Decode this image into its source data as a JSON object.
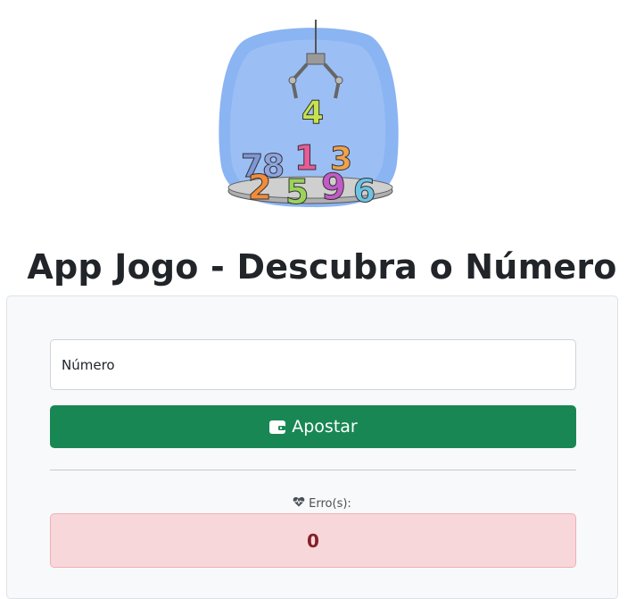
{
  "page": {
    "title": "App Jogo - Descubra o Número"
  },
  "hero": {
    "image_icon": "claw-machine-numbers-illustration",
    "numbers": [
      "4",
      "7",
      "8",
      "1",
      "3",
      "2",
      "5",
      "9",
      "6"
    ]
  },
  "form": {
    "placeholder": "Número"
  },
  "bet_button": {
    "label": "Apostar",
    "icon": "wallet-icon",
    "color": "#198754"
  },
  "errors": {
    "label": "Erro(s):",
    "icon": "heart-pulse-icon",
    "count": "0",
    "bg_color": "#f8d7da",
    "text_color": "#842029"
  }
}
